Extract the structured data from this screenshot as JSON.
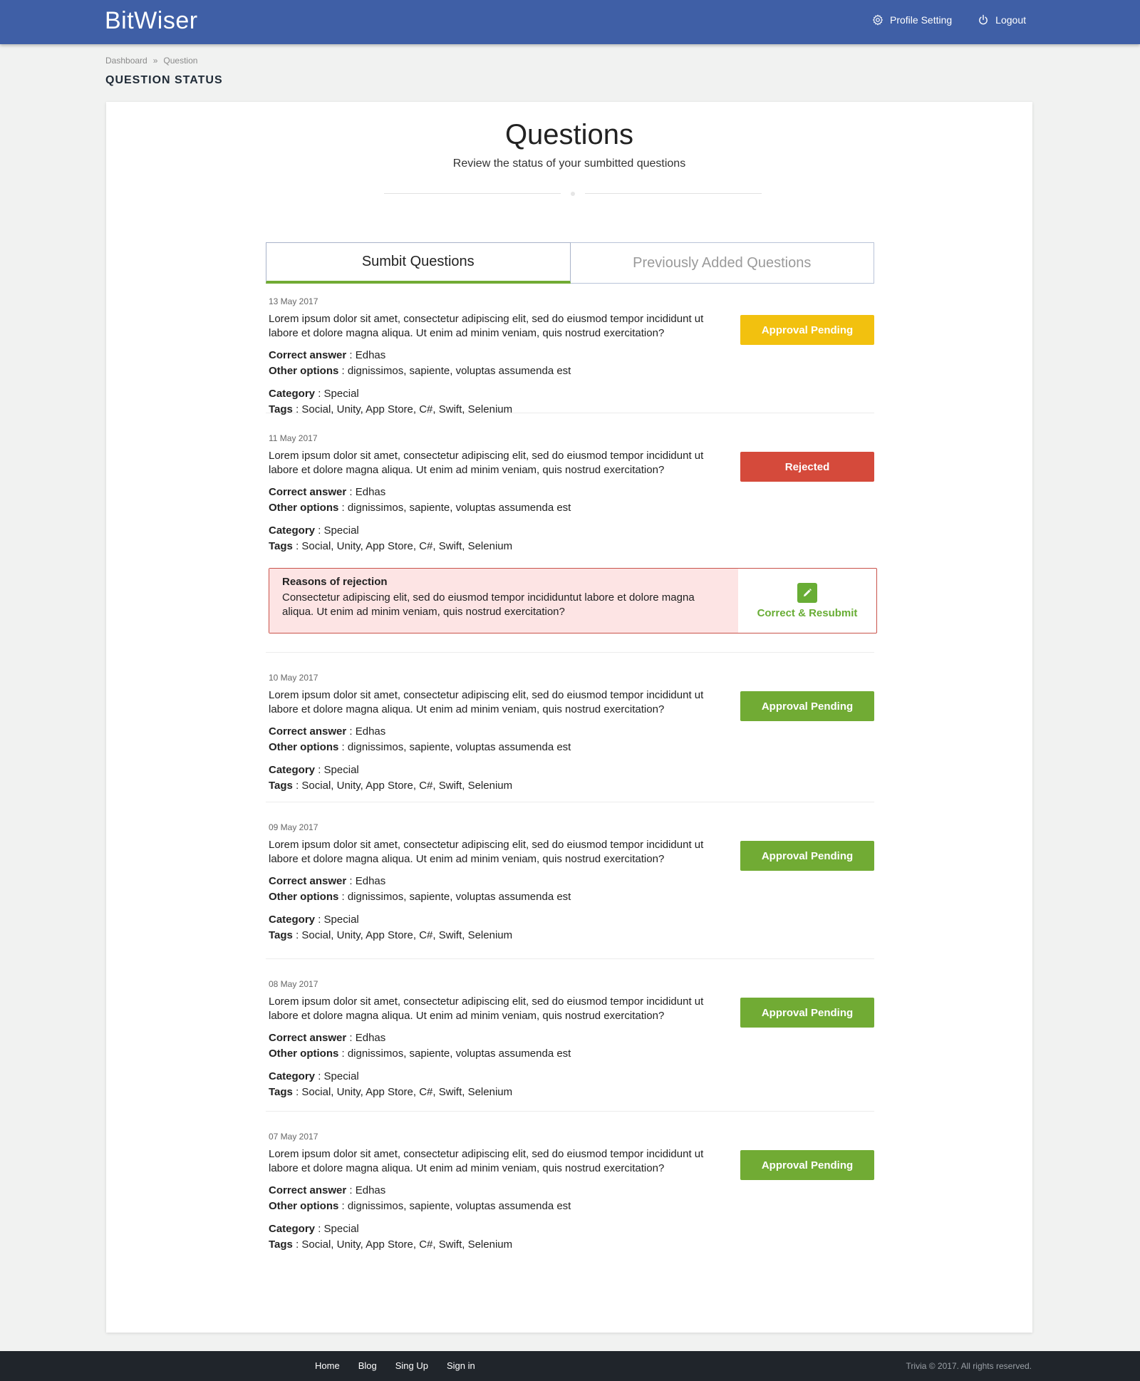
{
  "header": {
    "brand": "BitWiser",
    "profile_label": "Profile Setting",
    "logout_label": "Logout"
  },
  "breadcrumb": {
    "items": [
      "Dashboard",
      "»",
      "Question"
    ]
  },
  "page_title": "QUESTION STATUS",
  "hero": {
    "title": "Questions",
    "subtitle": "Review the status of your sumbitted questions"
  },
  "tabs": [
    {
      "label": "Sumbit Questions",
      "active": true
    },
    {
      "label": "Previously Added Questions",
      "active": false
    }
  ],
  "labels": {
    "correct_answer": "Correct answer",
    "other_options": "Other options",
    "category": "Category",
    "tags": "Tags"
  },
  "colors": {
    "brand": "#3f5fa6",
    "pending_yellow": "#f2c10f",
    "pending_green": "#71ab34",
    "rejected": "#d54a3b",
    "footer": "#20252b"
  },
  "questions": [
    {
      "date": "13 May 2017",
      "text": "Lorem ipsum dolor sit amet, consectetur adipiscing elit, sed do eiusmod tempor incididunt ut labore et dolore magna aliqua. Ut enim ad minim veniam, quis nostrud exercitation?",
      "correct_answer": "Edhas",
      "other_options": "dignissimos, sapiente, voluptas assumenda est",
      "category": "Special",
      "tags": "Social, Unity, App Store, C#, Swift, Selenium",
      "status": "Approval Pending",
      "status_color": "#f2c10f"
    },
    {
      "date": "11 May 2017",
      "text": "Lorem ipsum dolor sit amet, consectetur adipiscing elit, sed do eiusmod tempor incididunt ut labore et dolore magna aliqua. Ut enim ad minim veniam, quis nostrud exercitation?",
      "correct_answer": "Edhas",
      "other_options": "dignissimos, sapiente, voluptas assumenda est",
      "category": "Special",
      "tags": "Social, Unity, App Store, C#, Swift, Selenium",
      "status": "Rejected",
      "status_color": "#d54a3b",
      "rejection": {
        "title": "Reasons of rejection",
        "text": "Consectetur adipiscing elit, sed do eiusmod tempor incididuntut labore et dolore magna aliqua. Ut enim ad minim veniam, quis nostrud exercitation?",
        "action_label": "Correct & Resubmit",
        "action_icon": "pencil-icon"
      }
    },
    {
      "date": "10 May 2017",
      "text": "Lorem ipsum dolor sit amet, consectetur adipiscing elit, sed do eiusmod tempor incididunt ut labore et dolore magna aliqua. Ut enim ad minim veniam, quis nostrud exercitation?",
      "correct_answer": "Edhas",
      "other_options": "dignissimos, sapiente, voluptas assumenda est",
      "category": "Special",
      "tags": "Social, Unity, App Store, C#, Swift, Selenium",
      "status": "Approval Pending",
      "status_color": "#71ab34"
    },
    {
      "date": "09 May 2017",
      "text": "Lorem ipsum dolor sit amet, consectetur adipiscing elit, sed do eiusmod tempor incididunt ut labore et dolore magna aliqua. Ut enim ad minim veniam, quis nostrud exercitation?",
      "correct_answer": "Edhas",
      "other_options": "dignissimos, sapiente, voluptas assumenda est",
      "category": "Special",
      "tags": "Social, Unity, App Store, C#, Swift, Selenium",
      "status": "Approval Pending",
      "status_color": "#71ab34"
    },
    {
      "date": "08 May 2017",
      "text": "Lorem ipsum dolor sit amet, consectetur adipiscing elit, sed do eiusmod tempor incididunt ut labore et dolore magna aliqua. Ut enim ad minim veniam, quis nostrud exercitation?",
      "correct_answer": "Edhas",
      "other_options": "dignissimos, sapiente, voluptas assumenda est",
      "category": "Special",
      "tags": "Social, Unity, App Store, C#, Swift, Selenium",
      "status": "Approval Pending",
      "status_color": "#71ab34"
    },
    {
      "date": "07 May 2017",
      "text": "Lorem ipsum dolor sit amet, consectetur adipiscing elit, sed do eiusmod tempor incididunt ut labore et dolore magna aliqua. Ut enim ad minim veniam, quis nostrud exercitation?",
      "correct_answer": "Edhas",
      "other_options": "dignissimos, sapiente, voluptas assumenda est",
      "category": "Special",
      "tags": "Social, Unity, App Store, C#, Swift, Selenium",
      "status": "Approval Pending",
      "status_color": "#71ab34"
    }
  ],
  "footer": {
    "links": [
      "Home",
      "Blog",
      "Sing Up",
      "Sign in"
    ],
    "copyright": "Trivia © 2017. All rights reserved."
  }
}
